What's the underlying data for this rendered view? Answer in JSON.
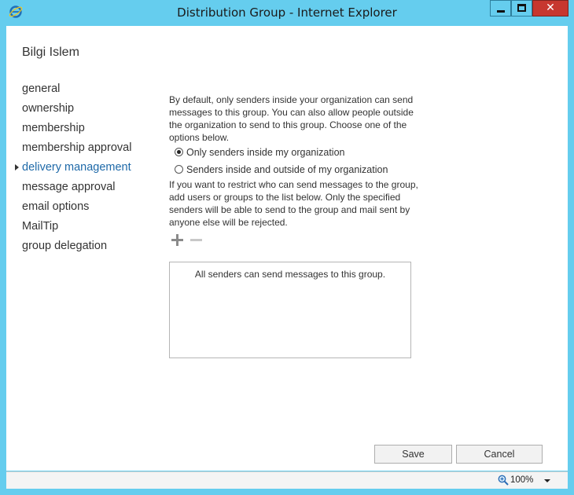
{
  "window": {
    "title": "Distribution Group - Internet Explorer",
    "close_glyph": "✕"
  },
  "group": {
    "name": "Bilgi Islem"
  },
  "nav": {
    "items": [
      {
        "label": "general"
      },
      {
        "label": "ownership"
      },
      {
        "label": "membership"
      },
      {
        "label": "membership approval"
      },
      {
        "label": "delivery management",
        "active": true
      },
      {
        "label": "message approval"
      },
      {
        "label": "email options"
      },
      {
        "label": "MailTip"
      },
      {
        "label": "group delegation"
      }
    ]
  },
  "delivery": {
    "intro": "By default, only senders inside your organization can send messages to this group. You can also allow people outside the organization to send to this group. Choose one of the options below.",
    "option_inside": "Only senders inside my organization",
    "option_inside_outside": "Senders inside and outside of my organization",
    "selected_option": "inside",
    "restrict_text": "If you want to restrict who can send messages to the group, add users or groups to the list below. Only the specified senders will be able to send to the group and mail sent by anyone else will be rejected.",
    "list_empty_text": "All senders can send messages to this group."
  },
  "buttons": {
    "save": "Save",
    "cancel": "Cancel"
  },
  "statusbar": {
    "zoom": "100%"
  },
  "colors": {
    "titlebar": "#65cdee",
    "active_nav": "#1e69a8",
    "close": "#c7372f"
  }
}
